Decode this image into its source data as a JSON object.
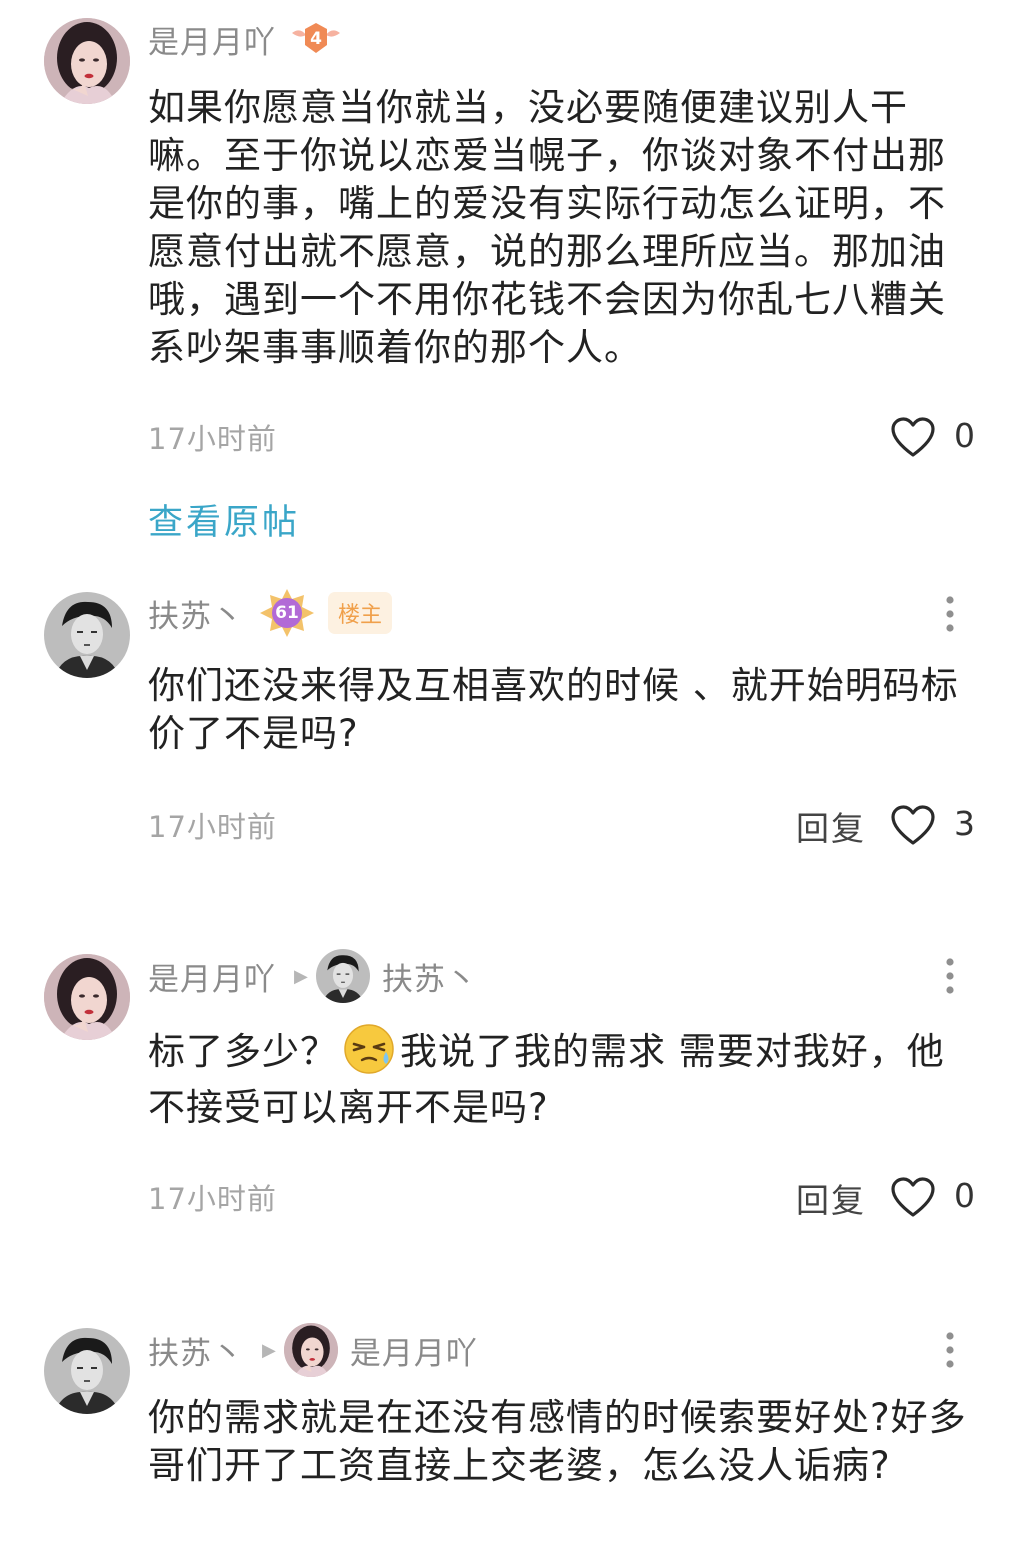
{
  "comments": [
    {
      "username": "是月月吖",
      "level": "4",
      "text": "如果你愿意当你就当，没必要随便建议别人干嘛。至于你说以恋爱当幌子，你谈对象不付出那是你的事，嘴上的爱没有实际行动怎么证明，不愿意付出就不愿意，说的那么理所应当。那加油哦，遇到一个不用你花钱不会因为你乱七八糟关系吵架事事顺着你的那个人。",
      "time": "17小时前",
      "likes": "0",
      "view_original": "查看原帖"
    },
    {
      "username": "扶苏丶",
      "level": "61",
      "op_badge": "楼主",
      "text": "你们还没来得及互相喜欢的时候 、就开始明码标价了不是吗?",
      "time": "17小时前",
      "reply_label": "回复",
      "likes": "3"
    },
    {
      "username": "是月月吖",
      "reply_to": "扶苏丶",
      "text_before_emoji": "标了多少？",
      "text_after_emoji": "我说了我的需求 需要对我好，他不接受可以离开不是吗?",
      "time": "17小时前",
      "reply_label": "回复",
      "likes": "0"
    },
    {
      "username": "扶苏丶",
      "reply_to": "是月月吖",
      "text": "你的需求就是在还没有感情的时候索要好处?好多哥们开了工资直接上交老婆，怎么没人诟病?"
    }
  ],
  "icons": {
    "like": "heart-outline-icon",
    "more": "vertical-dots-icon",
    "reply_arrow": "triangle-right-icon",
    "emoji": "sweat-smile-emoji"
  },
  "colors": {
    "link": "#3aa6c8",
    "op_badge_bg": "#fdf1e1",
    "op_badge_text": "#f0a04b",
    "username": "#8a8a8a",
    "meta": "#a5a5a5"
  }
}
